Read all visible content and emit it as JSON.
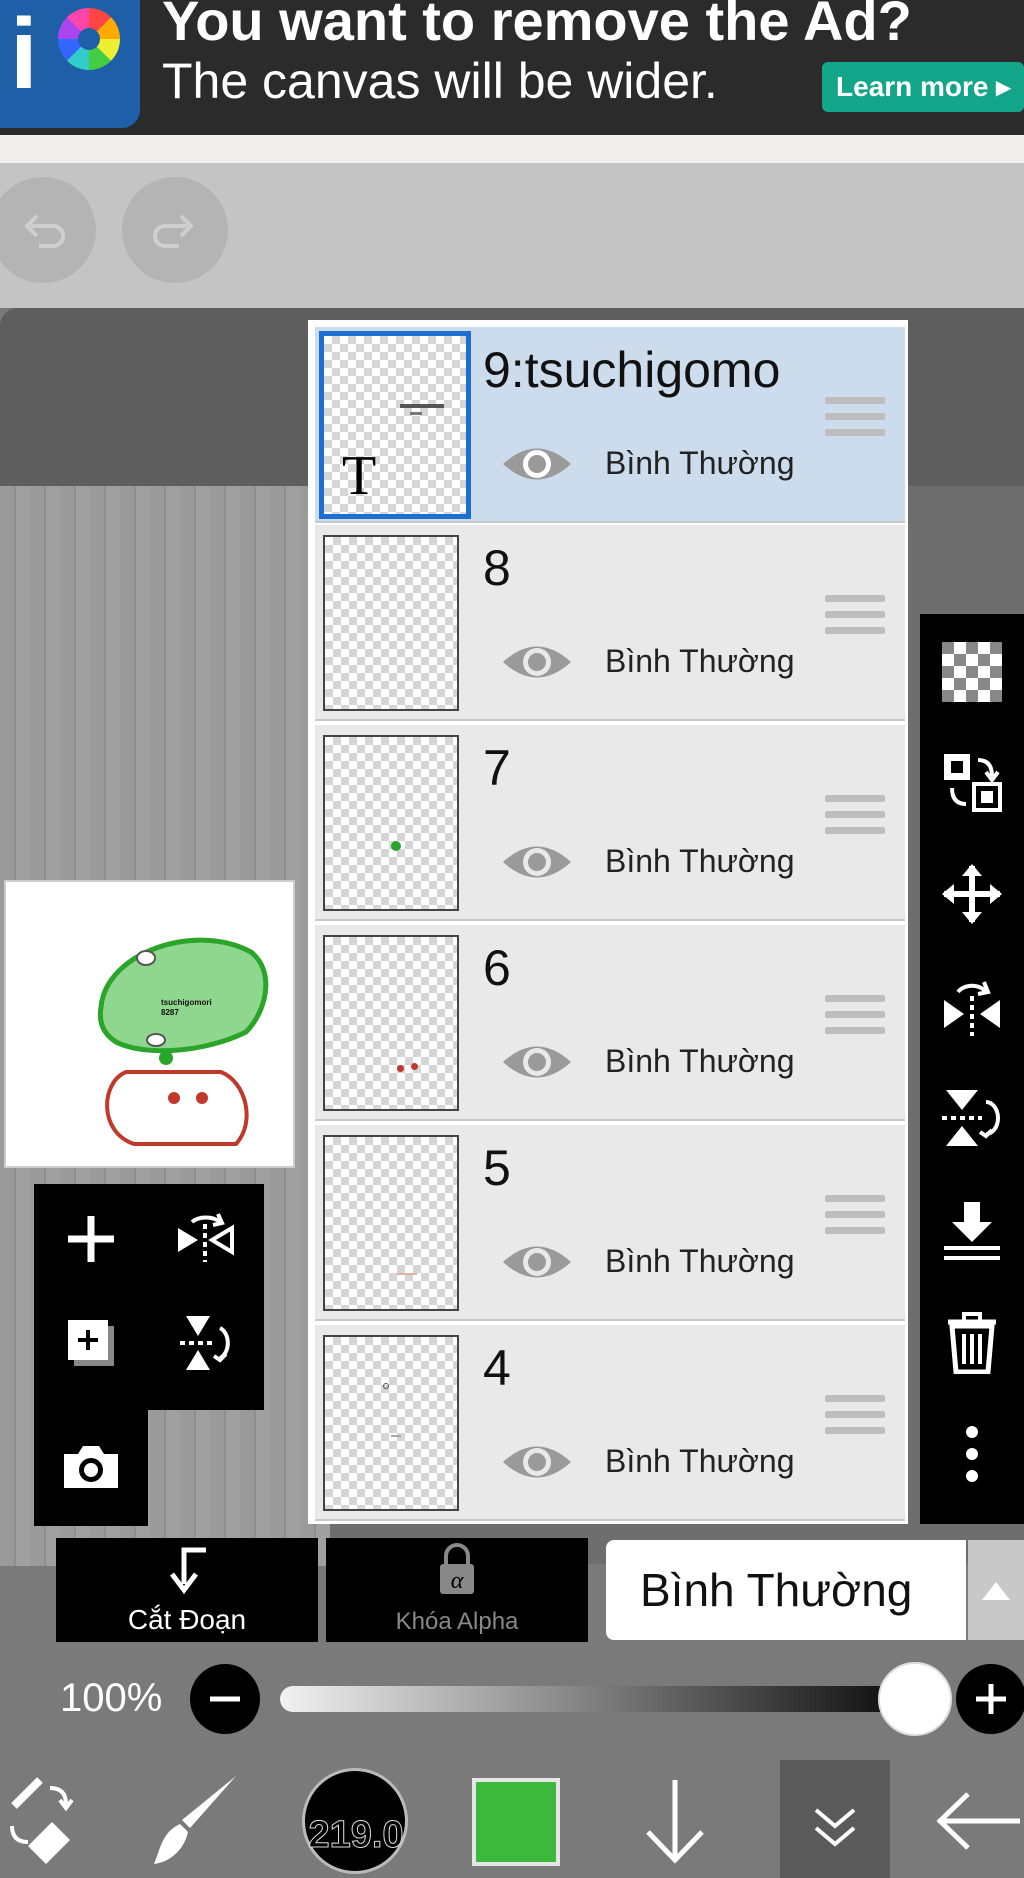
{
  "ad": {
    "title": "You want to remove the Ad?",
    "subtitle": "The canvas will be wider.",
    "button": "Learn more ▸"
  },
  "toolbar": {
    "undo_icon": "undo-icon",
    "redo_icon": "redo-icon"
  },
  "layers": [
    {
      "name": "9:tsuchigomo",
      "blend": "Bình Thường",
      "selected": true,
      "text_layer_glyph": "T"
    },
    {
      "name": "8",
      "blend": "Bình Thường"
    },
    {
      "name": "7",
      "blend": "Bình Thường"
    },
    {
      "name": "6",
      "blend": "Bình Thường"
    },
    {
      "name": "5",
      "blend": "Bình Thường"
    },
    {
      "name": "4",
      "blend": "Bình Thường"
    }
  ],
  "preview": {
    "caption": "tsuchigomori\n8287"
  },
  "bottom": {
    "clip_label": "Cắt Đoạn",
    "alpha_lock_label": "Khóa Alpha",
    "blend_mode": "Bình Thường",
    "opacity": "100%",
    "opacity_value": 1.0,
    "brush_size": "219.0",
    "color": "#3cb93c"
  },
  "colors": {
    "selected_layer_bg": "#ccdcec",
    "selection_border": "#1a6fd0",
    "ad_button": "#12a58a"
  }
}
